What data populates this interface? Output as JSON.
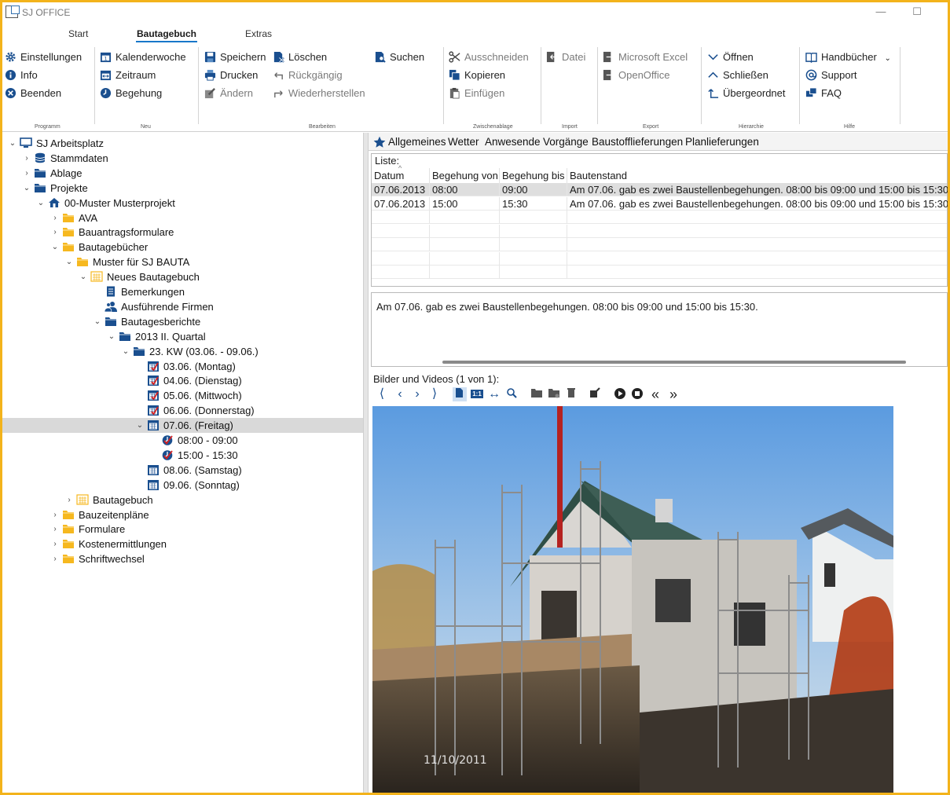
{
  "window": {
    "title": "SJ OFFICE",
    "minimize": "—",
    "maximize": "☐"
  },
  "ribbon_tabs": [
    {
      "label": "Start"
    },
    {
      "label": "Bautagebuch"
    },
    {
      "label": "Extras"
    }
  ],
  "ribbon": {
    "programm": {
      "label": "Programm",
      "items": [
        {
          "label": "Einstellungen"
        },
        {
          "label": "Info"
        },
        {
          "label": "Beenden"
        }
      ]
    },
    "neu": {
      "label": "Neu",
      "items": [
        {
          "label": "Kalenderwoche"
        },
        {
          "label": "Zeitraum"
        },
        {
          "label": "Begehung"
        }
      ]
    },
    "bearbeiten": {
      "label": "Bearbeiten",
      "items": [
        {
          "label": "Speichern"
        },
        {
          "label": "Drucken"
        },
        {
          "label": "Ändern"
        },
        {
          "label": "Löschen"
        },
        {
          "label": "Rückgängig"
        },
        {
          "label": "Wiederherstellen"
        },
        {
          "label": "Suchen"
        }
      ]
    },
    "zwischenablage": {
      "label": "Zwischenablage",
      "items": [
        {
          "label": "Ausschneiden"
        },
        {
          "label": "Kopieren"
        },
        {
          "label": "Einfügen"
        }
      ]
    },
    "import": {
      "label": "Import",
      "items": [
        {
          "label": "Datei"
        }
      ]
    },
    "export": {
      "label": "Export",
      "items": [
        {
          "label": "Microsoft Excel"
        },
        {
          "label": "OpenOffice"
        }
      ]
    },
    "hierarchie": {
      "label": "Hierarchie",
      "items": [
        {
          "label": "Öffnen"
        },
        {
          "label": "Schließen"
        },
        {
          "label": "Übergeordnet"
        }
      ]
    },
    "hilfe": {
      "label": "Hilfe",
      "items": [
        {
          "label": "Handbücher"
        },
        {
          "label": "Support"
        },
        {
          "label": "FAQ"
        }
      ]
    }
  },
  "tree": [
    {
      "label": "SJ Arbeitsplatz",
      "icon": "computer-icon",
      "arrow": "⌄"
    },
    {
      "label": "Stammdaten",
      "icon": "database-icon",
      "arrow": "›"
    },
    {
      "label": "Ablage",
      "icon": "folder-blue-icon",
      "arrow": "›"
    },
    {
      "label": "Projekte",
      "icon": "folder-blue-icon",
      "arrow": "⌄"
    },
    {
      "label": "00-Muster Musterprojekt",
      "icon": "house-icon",
      "arrow": "⌄"
    },
    {
      "label": "AVA",
      "icon": "folder-yellow-icon",
      "arrow": "›"
    },
    {
      "label": "Bauantragsformulare",
      "icon": "folder-yellow-icon",
      "arrow": "›"
    },
    {
      "label": "Bautagebücher",
      "icon": "folder-yellow-icon",
      "arrow": "⌄"
    },
    {
      "label": "Muster für SJ BAUTA",
      "icon": "folder-yellow-icon",
      "arrow": "⌄"
    },
    {
      "label": "Neues Bautagebuch",
      "icon": "diary-icon",
      "arrow": "⌄"
    },
    {
      "label": "Bemerkungen",
      "icon": "document-icon",
      "arrow": ""
    },
    {
      "label": "Ausführende Firmen",
      "icon": "people-icon",
      "arrow": ""
    },
    {
      "label": "Bautagesberichte",
      "icon": "folder-blue-icon",
      "arrow": "⌄"
    },
    {
      "label": "2013 II. Quartal",
      "icon": "folder-blue-icon",
      "arrow": "⌄"
    },
    {
      "label": "23. KW (03.06. - 09.06.)",
      "icon": "folder-blue-icon",
      "arrow": "⌄"
    },
    {
      "label": "03.06. (Montag)",
      "icon": "calendar-check-icon",
      "arrow": ""
    },
    {
      "label": "04.06. (Dienstag)",
      "icon": "calendar-check-icon",
      "arrow": ""
    },
    {
      "label": "05.06. (Mittwoch)",
      "icon": "calendar-check-icon",
      "arrow": ""
    },
    {
      "label": "06.06. (Donnerstag)",
      "icon": "calendar-check-icon",
      "arrow": ""
    },
    {
      "label": "07.06. (Freitag)",
      "icon": "calendar-icon",
      "arrow": "⌄"
    },
    {
      "label": "08:00 - 09:00",
      "icon": "visit-check-icon",
      "arrow": ""
    },
    {
      "label": "15:00 - 15:30",
      "icon": "visit-check-icon",
      "arrow": ""
    },
    {
      "label": "08.06. (Samstag)",
      "icon": "calendar-icon",
      "arrow": ""
    },
    {
      "label": "09.06. (Sonntag)",
      "icon": "calendar-icon",
      "arrow": ""
    },
    {
      "label": "Bautagebuch",
      "icon": "diary-icon",
      "arrow": "›"
    },
    {
      "label": "Bauzeitenpläne",
      "icon": "folder-yellow-icon",
      "arrow": "›"
    },
    {
      "label": "Formulare",
      "icon": "folder-yellow-icon",
      "arrow": "›"
    },
    {
      "label": "Kostenermittlungen",
      "icon": "folder-yellow-icon",
      "arrow": "›"
    },
    {
      "label": "Schriftwechsel",
      "icon": "folder-yellow-icon",
      "arrow": "›"
    }
  ],
  "detail_tabs": [
    {
      "label": "Allgemeines"
    },
    {
      "label": "Wetter"
    },
    {
      "label": "Anwesende"
    },
    {
      "label": "Vorgänge"
    },
    {
      "label": "Baustofflieferungen"
    },
    {
      "label": "Planlieferungen"
    }
  ],
  "list": {
    "label": "Liste:",
    "columns": [
      "Datum",
      "Begehung von",
      "Begehung bis",
      "Bautenstand"
    ],
    "rows": [
      [
        "07.06.2013",
        "08:00",
        "09:00",
        "Am 07.06. gab es zwei Baustellenbegehungen. 08:00 bis 09:00 und 15:00 bis 15:30."
      ],
      [
        "07.06.2013",
        "15:00",
        "15:30",
        "Am 07.06. gab es zwei Baustellenbegehungen. 08:00 bis 09:00 und 15:00 bis 15:30."
      ]
    ]
  },
  "note": "Am 07.06. gab es zwei Baustellenbegehungen. 08:00 bis 09:00 und 15:00 bis 15:30.",
  "media": {
    "label": "Bilder und Videos (1 von 1):",
    "photo_date": "11/10/2011"
  },
  "colors": {
    "accent": "#1877c9",
    "frame": "#f3b31b",
    "icon_blue": "#1a4f8f",
    "folder_yellow": "#f6b81f"
  }
}
